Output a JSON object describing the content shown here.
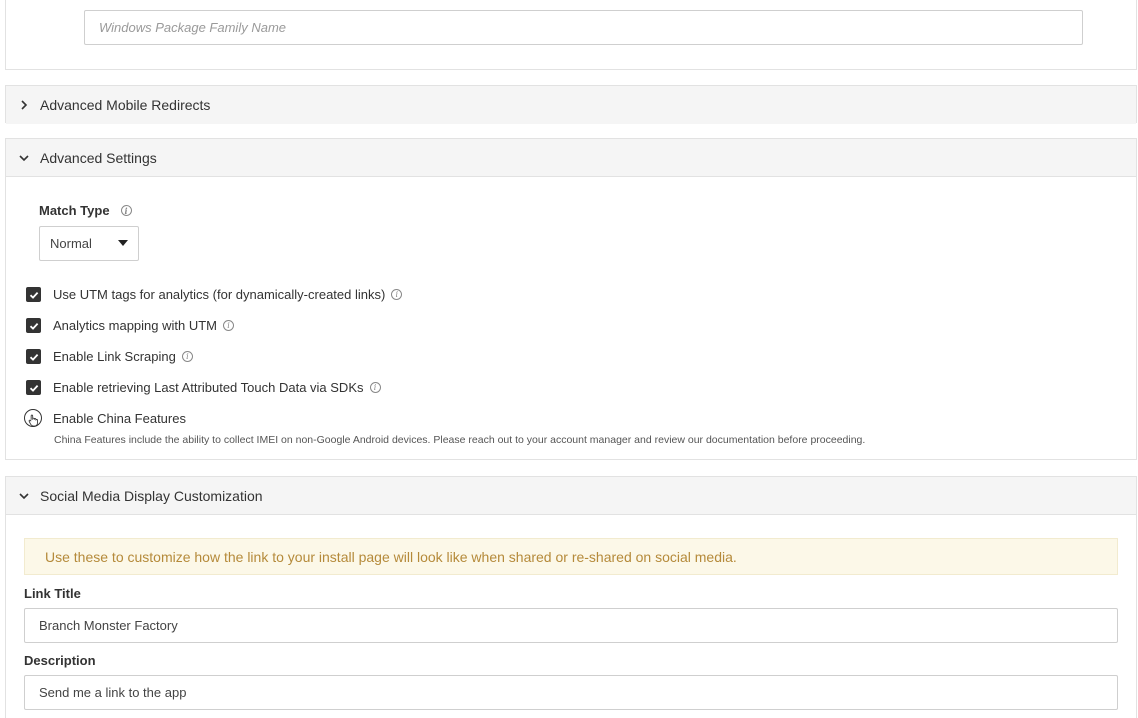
{
  "top_panel": {
    "field_placeholder": "Windows Package Family Name"
  },
  "advanced_mobile": {
    "title": "Advanced Mobile Redirects"
  },
  "advanced_settings": {
    "title": "Advanced Settings",
    "match_type_label": "Match Type",
    "match_type_value": "Normal",
    "options": [
      {
        "label": "Use UTM tags for analytics (for dynamically-created links)",
        "checked": true
      },
      {
        "label": "Analytics mapping with UTM",
        "checked": true
      },
      {
        "label": "Enable Link Scraping",
        "checked": true
      },
      {
        "label": "Enable retrieving Last Attributed Touch Data via SDKs",
        "checked": true
      },
      {
        "label": "Enable China Features",
        "checked": false
      }
    ],
    "china_description": "China Features include the ability to collect IMEI on non-Google Android devices. Please reach out to your account manager and review our documentation before proceeding."
  },
  "social": {
    "title": "Social Media Display Customization",
    "notice": "Use these to customize how the link to your install page will look like when shared or re-shared on social media.",
    "link_title_label": "Link Title",
    "link_title_value": "Branch Monster Factory",
    "description_label": "Description",
    "description_value": "Send me a link to the app"
  }
}
